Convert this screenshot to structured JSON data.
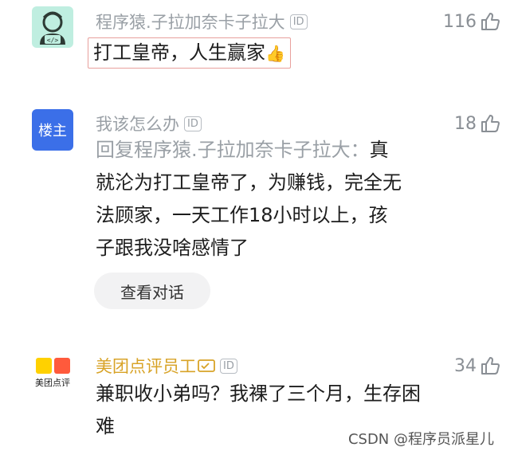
{
  "comments": [
    {
      "author": "程序猿.子拉加奈卡子拉大",
      "id_badge": "ID",
      "text": "打工皇帝，人生赢家",
      "emoji": "👍",
      "likes": "116"
    },
    {
      "avatar_label": "楼主",
      "author": "我该怎么办",
      "id_badge": "ID",
      "reply_prefix": "回复程序猿.子拉加奈卡子拉大：",
      "text": "真就沦为打工皇帝了，为赚钱，完全无法顾家，一天工作18小时以上，孩子跟我没啥感情了",
      "view_dialog": "查看对话",
      "likes": "18"
    },
    {
      "avatar_label": "美团点评",
      "author": "美团点评员工",
      "id_badge": "ID",
      "text": "兼职收小弟吗？我裸了三个月，生存困难",
      "likes": "34"
    }
  ],
  "watermark": "CSDN @程序员派星儿",
  "colors": {
    "accent_gold": "#d8a327",
    "host_badge_blue": "#3b6fe8",
    "meta_gray": "#9aa0a6"
  }
}
